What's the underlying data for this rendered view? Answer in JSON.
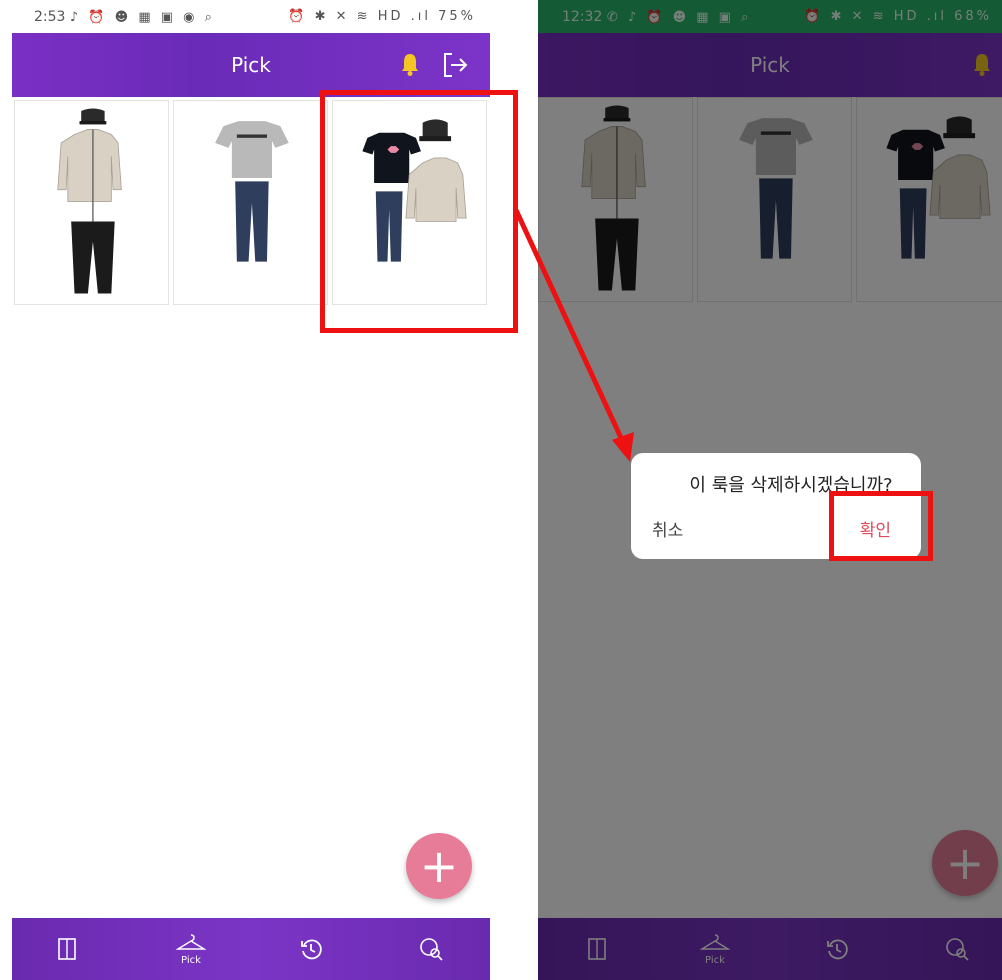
{
  "left_screen": {
    "status_time": "2:53",
    "status_icons": "♪ ⏰ ☻ ▦ ▣ ◉ ⌕",
    "status_right": "⏰ ✱ ✕ ≋ HD .ıl 75%",
    "header_title": "Pick",
    "icons": [
      "bell-icon",
      "logout-icon"
    ],
    "fab_label": "+",
    "tabs": [
      {
        "icon": "closet-icon",
        "label": ""
      },
      {
        "icon": "hanger-icon",
        "label": "Pick"
      },
      {
        "icon": "history-icon",
        "label": ""
      },
      {
        "icon": "person-search-icon",
        "label": ""
      }
    ]
  },
  "right_screen": {
    "status_time": "12:32",
    "status_icons": "✆ ♪ ⏰ ☻ ▦ ▣ ⌕",
    "status_right": "⏰ ✱ ✕ ≋ HD .ıl 68%",
    "header_title": "Pick",
    "fab_label": "+",
    "tab_label": "Pick",
    "dialog": {
      "message": "이 룩을 삭제하시겠습니까?",
      "cancel": "취소",
      "confirm": "확인"
    }
  },
  "colors": {
    "header": "#7a2fc4",
    "fab": "#e77c98",
    "highlight": "#ee1111",
    "confirm_text": "#e04a5e",
    "status_bar_right": "#28b46a"
  }
}
